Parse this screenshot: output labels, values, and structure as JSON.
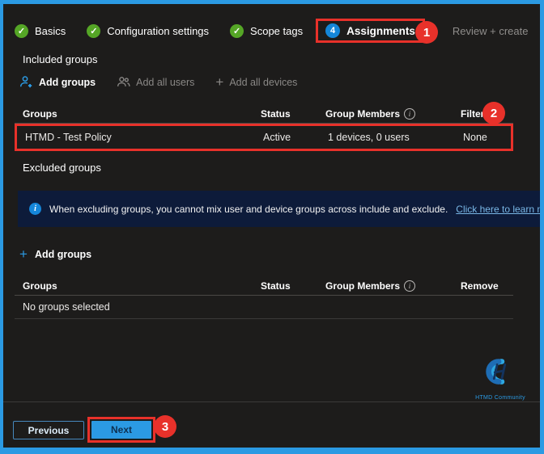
{
  "colors": {
    "frame_border": "#2b9ae3",
    "background": "#1d1c1b",
    "accent_blue": "#2b9ae3",
    "success_green": "#55a626",
    "annotation_red": "#e8312a",
    "banner_background": "#0d1b3a",
    "link_blue": "#79b7e6",
    "muted_gray": "#8a8886",
    "step_badge_blue": "#1486d8",
    "next_button_blue": "#2b9ae3"
  },
  "wizard": {
    "tabs": [
      {
        "label": "Basics",
        "state": "completed"
      },
      {
        "label": "Configuration settings",
        "state": "completed"
      },
      {
        "label": "Scope tags",
        "state": "completed"
      },
      {
        "label": "Assignments",
        "state": "active",
        "step_number": "4"
      },
      {
        "label": "Review + create",
        "state": "upcoming"
      }
    ]
  },
  "included_groups": {
    "heading": "Included groups",
    "actions": [
      {
        "label": "Add groups",
        "icon": "person-add-icon",
        "enabled": true
      },
      {
        "label": "Add all users",
        "icon": "people-icon",
        "enabled": false
      },
      {
        "label": "Add all devices",
        "icon": "plus-icon",
        "enabled": false
      }
    ],
    "table": {
      "headers": [
        "Groups",
        "Status",
        "Group Members",
        "Filter"
      ],
      "rows": [
        {
          "group": "HTMD - Test Policy",
          "status": "Active",
          "members": "1 devices, 0 users",
          "filter": "None"
        }
      ]
    }
  },
  "excluded_groups": {
    "heading": "Excluded groups",
    "info_banner": {
      "text": "When excluding groups, you cannot mix user and device groups across include and exclude.",
      "link_text": "Click here to learn more about"
    },
    "add_groups_label": "Add groups",
    "table": {
      "headers": [
        "Groups",
        "Status",
        "Group Members",
        "Remove"
      ],
      "empty_text": "No groups selected"
    }
  },
  "footer": {
    "previous_label": "Previous",
    "next_label": "Next"
  },
  "branding": {
    "community_name": "HTMD Community"
  },
  "annotations": {
    "steps": [
      "1",
      "2",
      "3"
    ]
  }
}
